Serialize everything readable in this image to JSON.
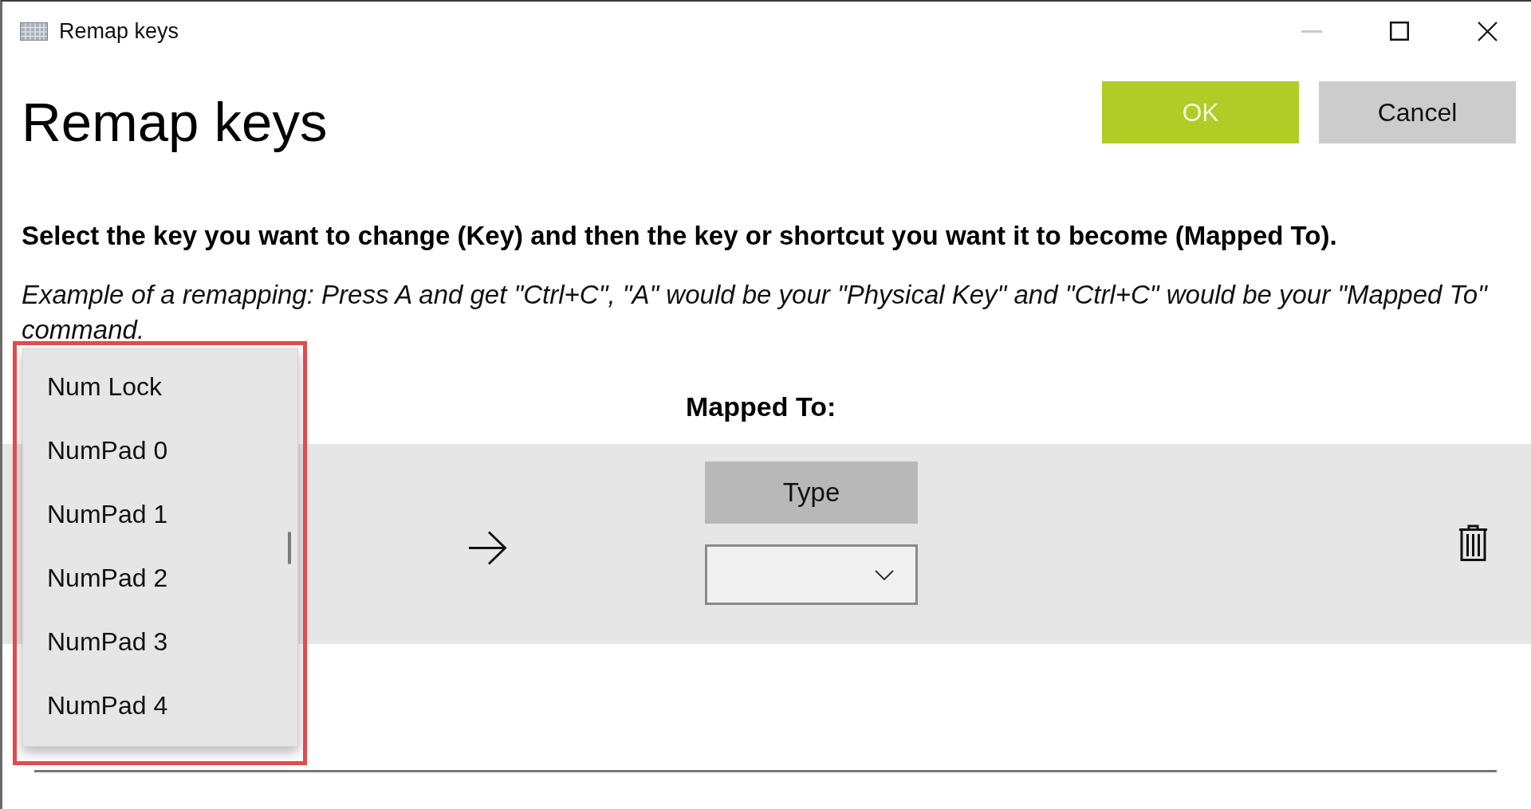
{
  "window": {
    "title": "Remap keys",
    "controls": [
      {
        "kind": "minimize",
        "disabled": true
      },
      {
        "kind": "maximize",
        "disabled": false
      },
      {
        "kind": "close",
        "disabled": false
      }
    ]
  },
  "heading": "Remap keys",
  "buttons": [
    {
      "label": "OK",
      "kind": "primary"
    },
    {
      "label": "Cancel",
      "kind": "secondary"
    }
  ],
  "instructions": "Select the key you want to change (Key) and then the key or shortcut you want it to become (Mapped To).",
  "example": "Example of a remapping: Press A and get \"Ctrl+C\", \"A\" would be your \"Physical Key\" and \"Ctrl+C\" would be your \"Mapped To\" command.",
  "mapped_to_header": "Mapped To:",
  "remap_rows": [
    {
      "key_dropdown": {
        "expanded": true,
        "options": [
          {
            "label": "Num Lock",
            "selected": false
          },
          {
            "label": "NumPad 0",
            "selected": false
          },
          {
            "label": "NumPad 1",
            "selected": false
          },
          {
            "label": "NumPad 2",
            "selected": false
          },
          {
            "label": "NumPad 3",
            "selected": false
          },
          {
            "label": "NumPad 4",
            "selected": false
          }
        ]
      },
      "type_button": "Type"
    }
  ]
}
